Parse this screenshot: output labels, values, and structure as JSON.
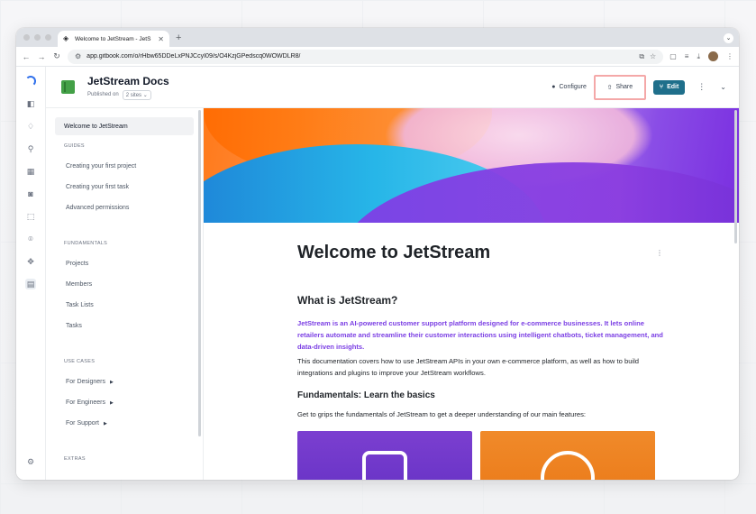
{
  "browser": {
    "tab_title": "Welcome to JetStream - JetS",
    "url": "app.gitbook.com/o/rHbw65DDeLxPNJCcyI09/s/O4KzjGPedscq0WOWDLR8/"
  },
  "header": {
    "space_title": "JetStream Docs",
    "published_label": "Published on",
    "sites_label": "2 sites",
    "configure_label": "Configure",
    "share_label": "Share",
    "edit_label": "Edit"
  },
  "nav": {
    "active": "Welcome to JetStream",
    "sections": [
      {
        "title": "GUIDES",
        "items": [
          "Creating your first project",
          "Creating your first task",
          "Advanced permissions"
        ]
      },
      {
        "title": "FUNDAMENTALS",
        "items": [
          "Projects",
          "Members",
          "Task Lists",
          "Tasks"
        ]
      },
      {
        "title": "USE CASES",
        "items": [
          "For Designers",
          "For Engineers",
          "For Support"
        ]
      },
      {
        "title": "EXTRAS",
        "items": []
      }
    ]
  },
  "article": {
    "title": "Welcome to JetStream",
    "h2": "What is JetStream?",
    "lead": "JetStream is an AI-powered customer support platform designed for e-commerce businesses. It lets online retailers automate and streamline their customer interactions using intelligent chatbots, ticket management, and data-driven insights.",
    "body": "This documentation covers how to use JetStream APIs in your own e-commerce platform, as well as how to build integrations and plugins to improve your JetStream workflows.",
    "h3": "Fundamentals: Learn the basics",
    "p2": "Get to grips the fundamentals of JetStream to get a deeper understanding of our main features:"
  },
  "colors": {
    "edit_button": "#1f6f8b",
    "lead_text": "#7b3fe4",
    "share_highlight": "#f4a8a8"
  }
}
